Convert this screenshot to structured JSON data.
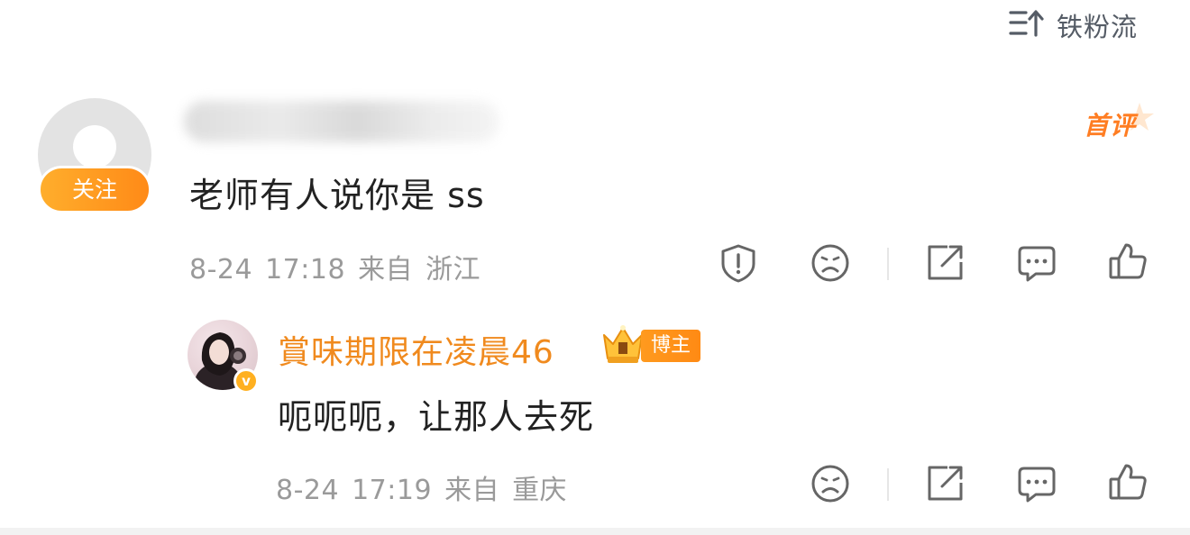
{
  "sort": {
    "label": "铁粉流",
    "icon": "sort-lines-arrow-icon"
  },
  "comments": [
    {
      "username_blurred": true,
      "follow_label": "关注",
      "badge_label": "首评",
      "text": "老师有人说你是 ss",
      "date": "8-24",
      "time": "17:18",
      "from_label": "来自",
      "location": "浙江",
      "actions": [
        "report-icon",
        "dislike-icon",
        "share-icon",
        "comment-icon",
        "like-icon"
      ]
    }
  ],
  "reply": {
    "username": "賞味期限在凌晨46",
    "author_badge": "博主",
    "verified_mark": "v",
    "text": "呃呃呃，让那人去死",
    "date": "8-24",
    "time": "17:19",
    "from_label": "来自",
    "location": "重庆",
    "actions": [
      "dislike-icon",
      "share-icon",
      "comment-icon",
      "like-icon"
    ]
  },
  "colors": {
    "accent_orange": "#ff8a17",
    "name_orange": "#f08a1e",
    "meta_gray": "#9a9a9a",
    "icon_gray": "#555c66"
  }
}
